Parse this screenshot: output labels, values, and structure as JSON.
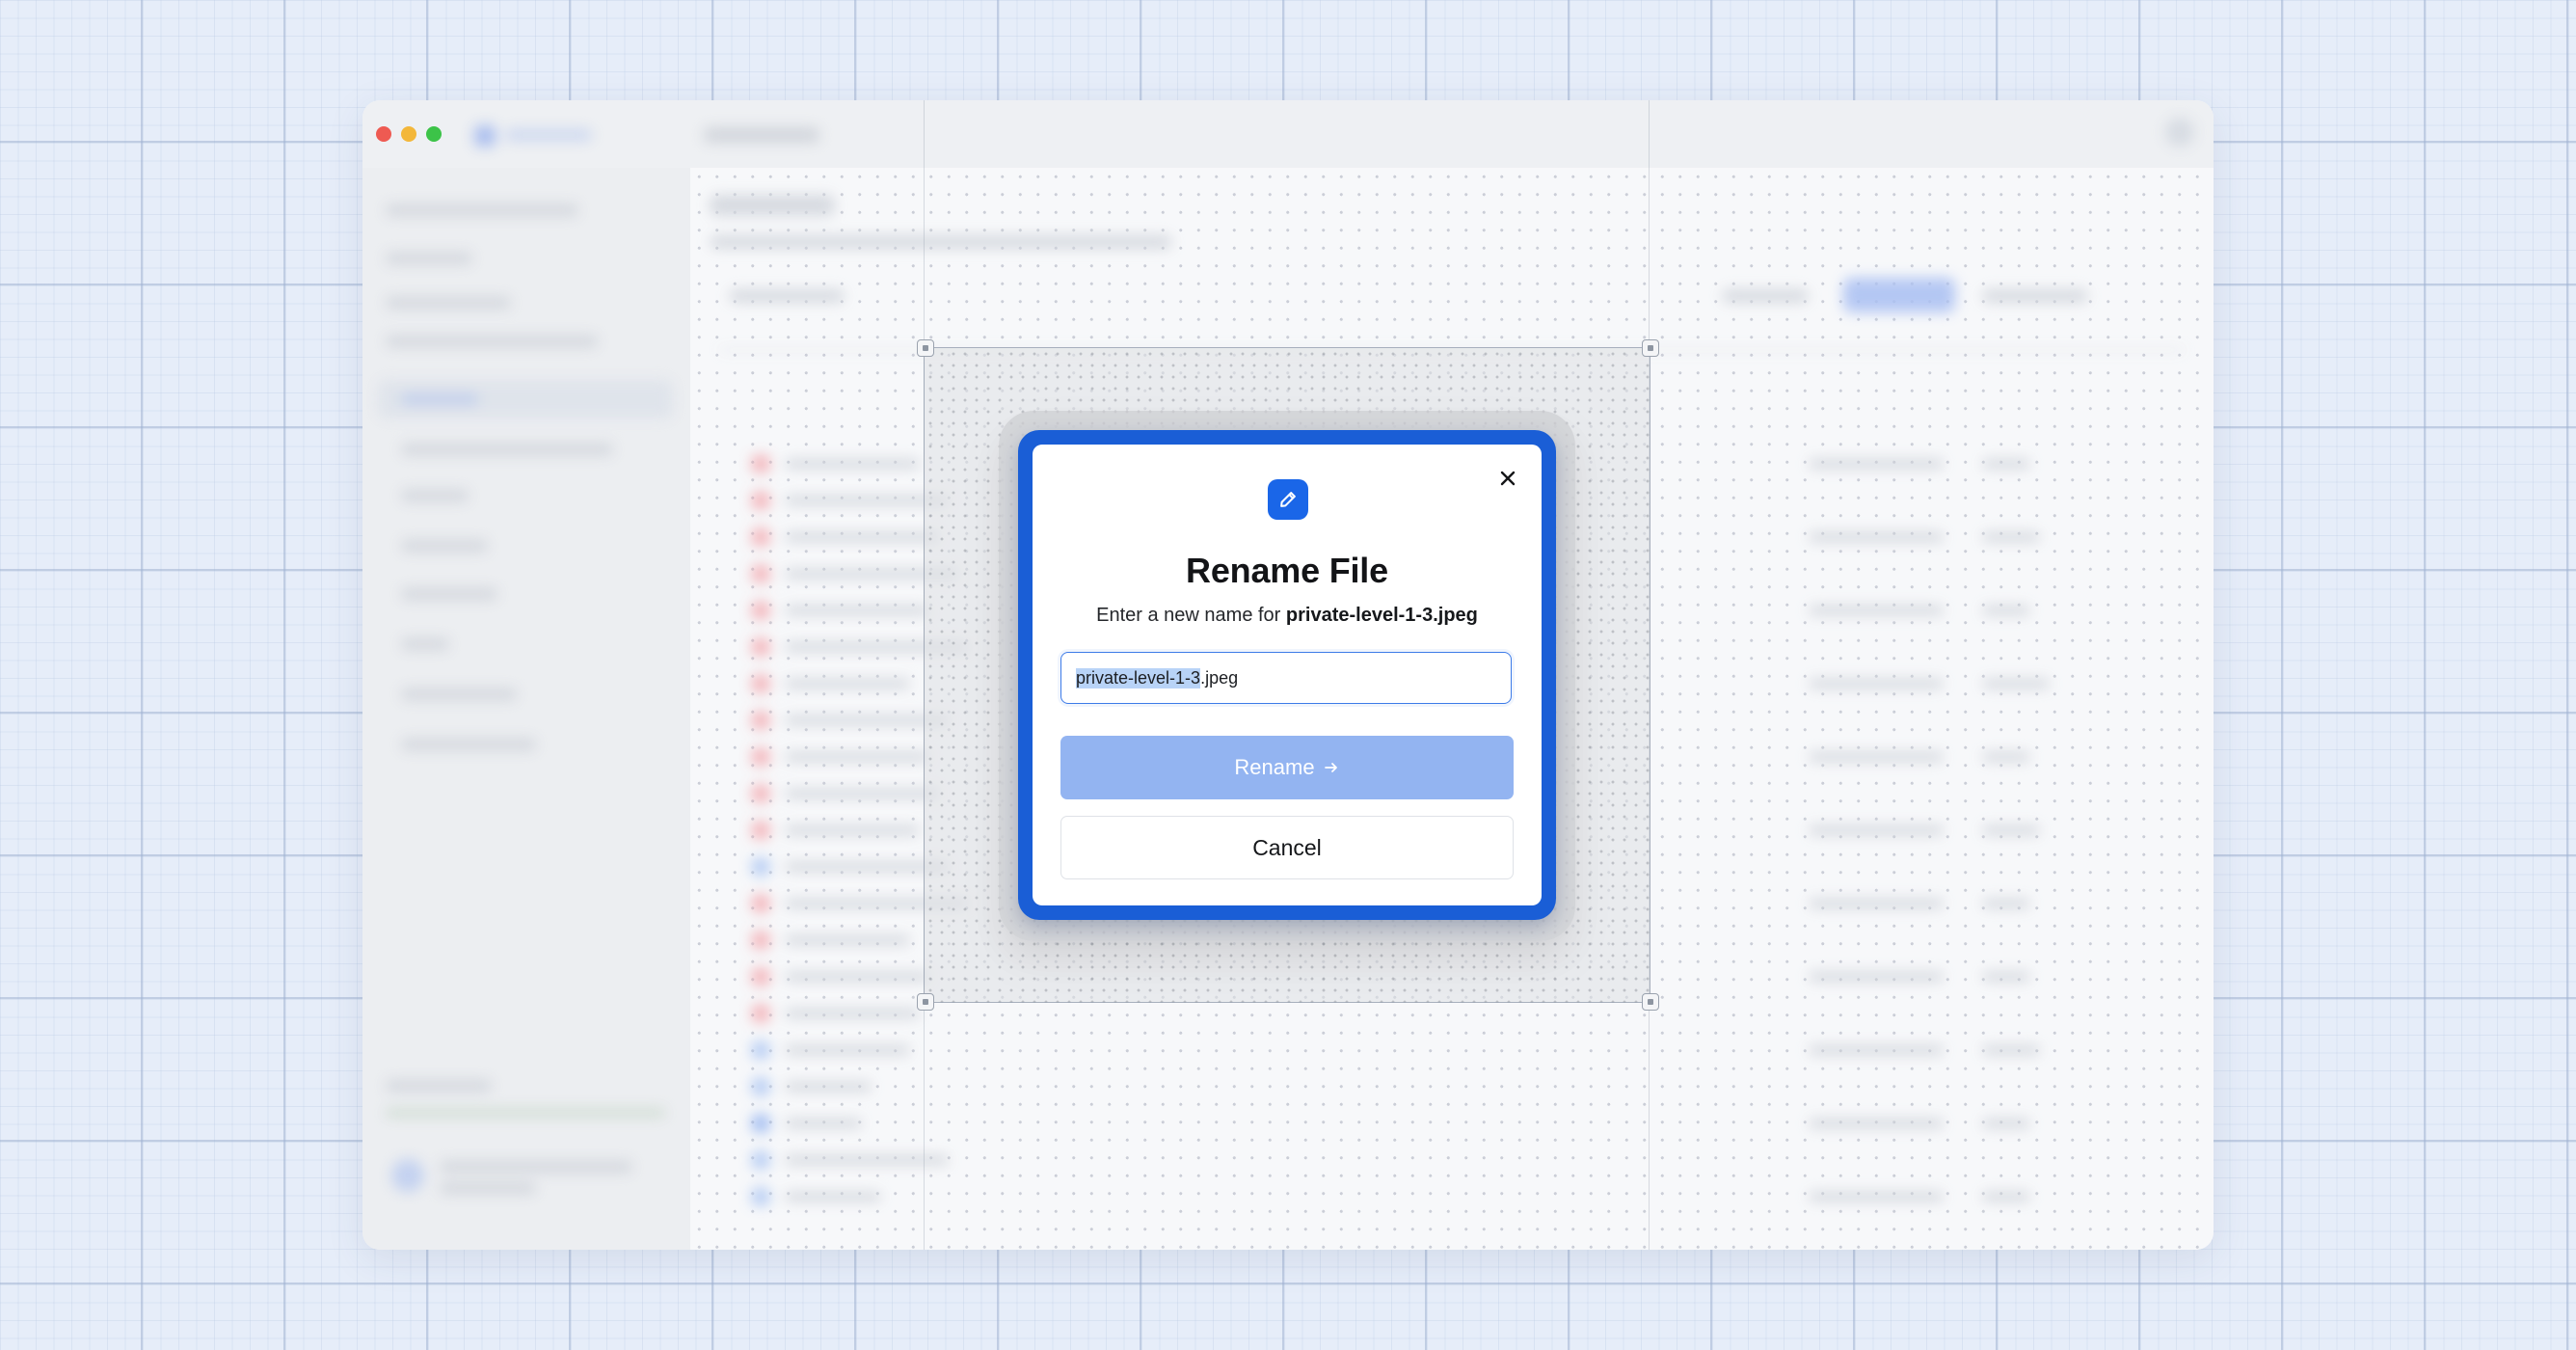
{
  "window": {
    "title": "",
    "traffic_lights": [
      "close",
      "minimize",
      "maximize"
    ]
  },
  "dialog": {
    "icon": "pencil-icon",
    "title": "Rename File",
    "subtitle_prefix": "Enter a new name for ",
    "file_name": "private-level-1-3.jpeg",
    "input": {
      "value_selected": "private-level-1-3",
      "value_rest": ".jpeg"
    },
    "primary_button": "Rename",
    "primary_button_icon": "arrow-right-icon",
    "secondary_button": "Cancel",
    "close_icon": "close-icon"
  },
  "colors": {
    "accent": "#1a5ed6",
    "primary_disabled": "#93b4f1",
    "text_selection": "#b8d3f7"
  }
}
